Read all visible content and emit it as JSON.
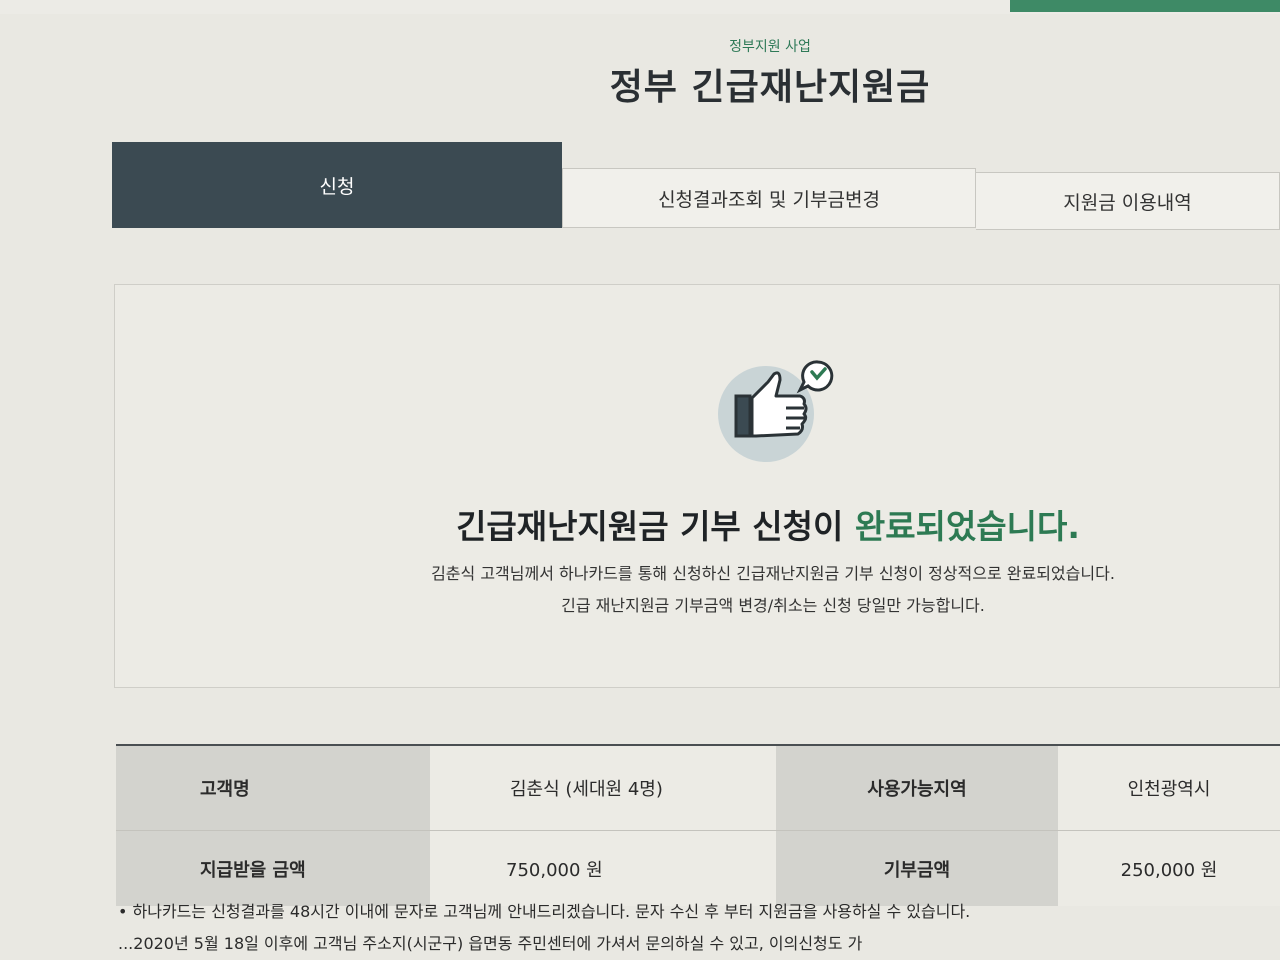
{
  "header": {
    "kicker": "정부지원 사업",
    "title": "정부 긴급재난지원금"
  },
  "tabs": [
    {
      "label": "신청",
      "active": true
    },
    {
      "label": "신청결과조회 및 기부금변경",
      "active": false
    },
    {
      "label": "지원금 이용내역",
      "active": false
    }
  ],
  "result": {
    "icon": "thumbs-up-check-icon",
    "headline_prefix": "긴급재난지원금 기부 신청이 ",
    "headline_emphasis": "완료되었습니다.",
    "desc_line1": "김춘식 고객님께서 하나카드를 통해 신청하신 긴급재난지원금 기부 신청이 정상적으로 완료되었습니다.",
    "desc_line2": "긴급 재난지원금 기부금액 변경/취소는 신청 당일만 가능합니다."
  },
  "info": {
    "customer_label": "고객명",
    "customer_value": "김춘식 (세대원 4명)",
    "region_label": "사용가능지역",
    "region_value": "인천광역시",
    "amount_label": "지급받을 금액",
    "amount_value": "750,000 원",
    "donation_label": "기부금액",
    "donation_value": "250,000 원"
  },
  "notes": {
    "line1": "• 하나카드는 신청결과를 48시간 이내에 문자로 고객님께 안내드리겠습니다. 문자 수신 후 부터 지원금을 사용하실 수 있습니다.",
    "line2": "  ...2020년 5월 18일 이후에 고객님 주소지(시군구) 읍면동 주민센터에 가셔서 문의하실 수 있고, 이의신청도 가"
  },
  "colors": {
    "accent_green": "#2d7a53",
    "tab_active_bg": "#3b4a52",
    "table_label_bg": "#d3d3ce"
  }
}
